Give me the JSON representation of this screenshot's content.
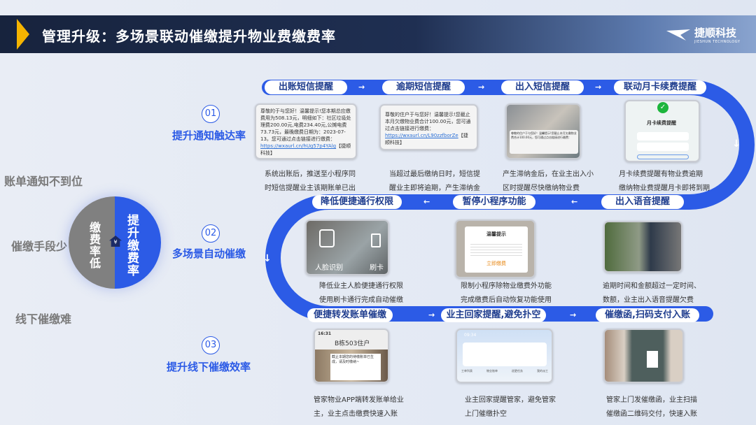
{
  "header": {
    "title": "管理升级：多场景联动催缴提升物业费缴费率",
    "logo_cn": "捷顺科技",
    "logo_en": "JIESHUN TECHNOLOGY"
  },
  "problems": [
    "账单通知不到位",
    "催缴手段少",
    "线下催缴难"
  ],
  "circle": {
    "left": "缴费率低",
    "right": "提升缴费率",
    "icon": "yuan-house-icon"
  },
  "steps": [
    {
      "num": "01",
      "title": "提升通知触达率"
    },
    {
      "num": "02",
      "title": "多场景自动催缴"
    },
    {
      "num": "03",
      "title": "提升线下催缴效率"
    }
  ],
  "row1": {
    "pills": [
      "出账短信提醒",
      "逾期短信提醒",
      "出入短信提醒",
      "联动月卡续费提醒"
    ],
    "sms1": {
      "text": "尊敬的于与您好！温馨提示!您本期总应缴费用为508.13元，明细如下：社区垃圾处理费200.00元,电费234.40元,公摊电费73.73元，最晚缴费日期为：2023-07-13。您可通过点击链接进行缴费：",
      "link": "https://wxaurl.cn/hUg57p4YAlg",
      "sign": "【捷顺科技】"
    },
    "sms2": {
      "text": "尊敬的住户于与您好！温馨提示!您截止本月欠缴物业费合计100.00元，您可通过点击链接进行缴费：",
      "link": "https://wxaurl.cn/L90zzfborZe",
      "sign": "【捷顺科技】"
    },
    "card4_title": "月卡续费提醒",
    "captions": [
      [
        "系统出账后，推送至小程序同",
        "时短信提醒业主该期账单已出"
      ],
      [
        "当超过最后缴纳日时，短信提",
        "醒业主即将逾期，产生滞纳金"
      ],
      [
        "产生滞纳金后，在业主出入小",
        "区时提醒尽快缴纳物业费"
      ],
      [
        "月卡续费提醒有物业费逾期",
        "缴纳物业费提醒月卡即将到期"
      ]
    ]
  },
  "row2": {
    "pills": [
      "降低便捷通行权限",
      "暂停小程序功能",
      "出入语音提醒"
    ],
    "face_label": "人脸识别",
    "card_label": "刷卡",
    "popup_title": "温馨提示",
    "popup_btn": "立即缴费",
    "captions": [
      [
        "降低业主人脸便捷通行权限",
        "使用刷卡通行完成自动催缴"
      ],
      [
        "限制小程序除物业缴费外功能",
        "完成缴费后自动恢复功能使用"
      ],
      [
        "逾期时间和金额超过一定时间、",
        "数额，业主出入语音提醒欠费"
      ]
    ]
  },
  "row3": {
    "pills": [
      "便捷转发账单催缴",
      "业主回家提醒,避免扑空",
      "催缴函,扫码支付入账"
    ],
    "chat_time": "16:31",
    "chat_title": "B栋503住户",
    "chat_msg": "截止本期您的待缴账单已生成，请及时缴纳~",
    "app_time": "09:34",
    "app_tabs": [
      "工单列表",
      "物业账单",
      "巡更任务",
      "我的派工"
    ],
    "captions": [
      [
        "管家物业APP端转发账单给业",
        "主，业主点击缴费快速入账"
      ],
      [
        "业主回家提醒管家，避免管家",
        "上门催缴扑空"
      ],
      [
        "管家上门发催缴函，业主扫描",
        "催缴函二维码交付，快速入账"
      ]
    ]
  },
  "colors": {
    "accent": "#2c5be6",
    "header": "#17233d",
    "chevron": "#f5b400"
  }
}
